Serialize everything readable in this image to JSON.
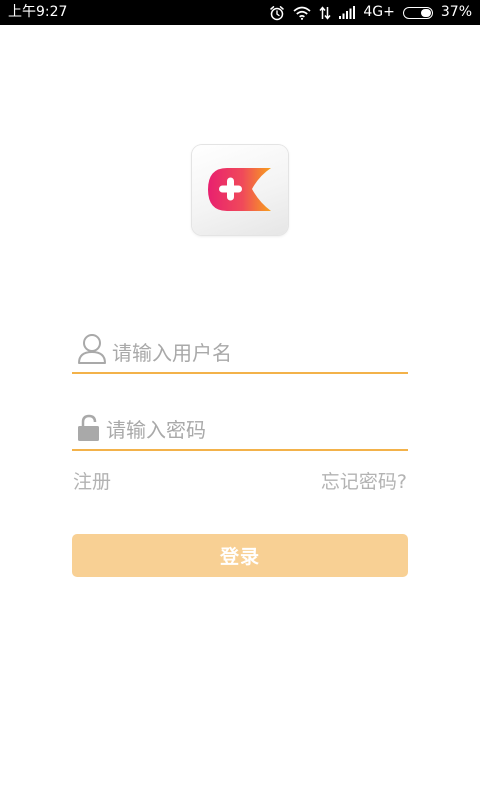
{
  "status_bar": {
    "time": "上午9:27",
    "network": "4G+",
    "battery_percent": "37%",
    "battery_level": 0.37,
    "icons": [
      "alarm-icon",
      "wifi-icon",
      "data-arrows-icon",
      "signal-icon",
      "battery-icon"
    ]
  },
  "logo": {
    "icon": "app-logo-icon",
    "colors": [
      "#e8206f",
      "#f7a11d"
    ]
  },
  "login_form": {
    "username": {
      "icon": "user-icon",
      "placeholder": "请输入用户名",
      "value": ""
    },
    "password": {
      "icon": "lock-icon",
      "placeholder": "请输入密码",
      "value": ""
    },
    "register_label": "注册",
    "forgot_password_label": "忘记密码?",
    "login_label": "登录"
  },
  "colors": {
    "accent": "#f3b24a",
    "button": "#f8d094",
    "placeholder": "#a9a9a9",
    "link": "#b3b3b3"
  }
}
